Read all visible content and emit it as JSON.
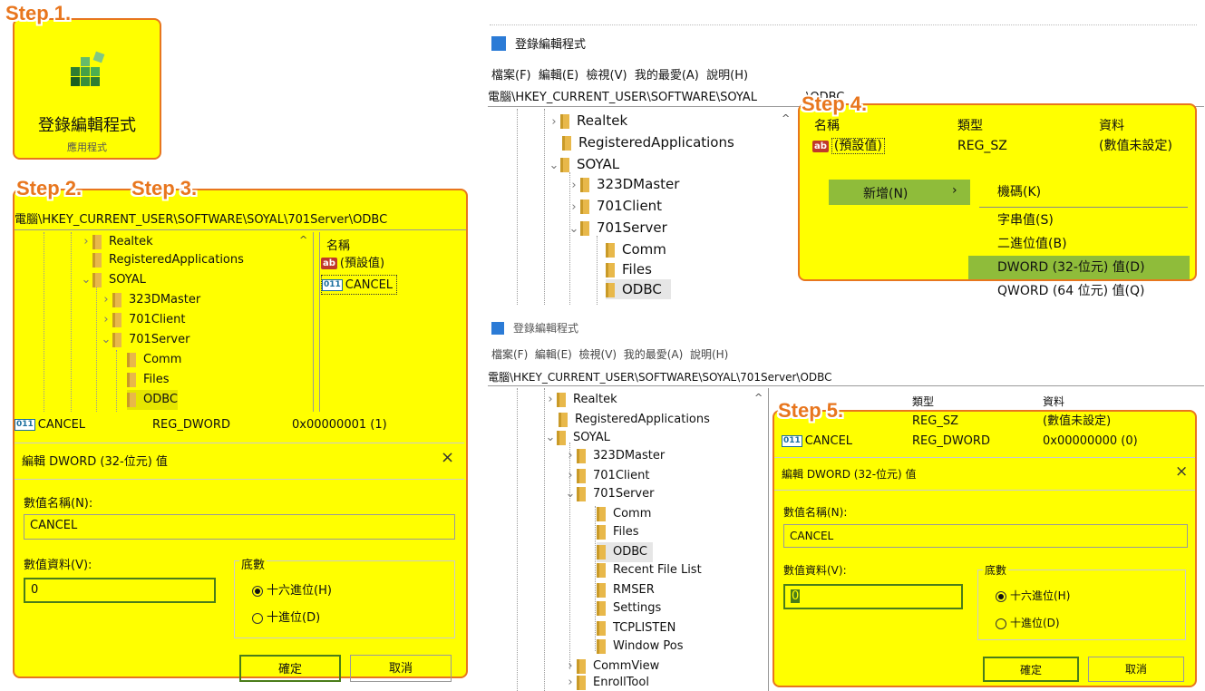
{
  "steps": {
    "s1": "Step 1.",
    "s2": "Step 2.",
    "s3": "Step 3.",
    "s4": "Step 4.",
    "s5": "Step 5."
  },
  "app_tile": {
    "title": "登錄編輯程式",
    "subtitle": "應用程式",
    "icon": "registry-editor-icon"
  },
  "registry": {
    "title": "登錄編輯程式",
    "menu": [
      "檔案(F)",
      "編輯(E)",
      "檢視(V)",
      "我的最愛(A)",
      "說明(H)"
    ],
    "path": "電腦\\HKEY_CURRENT_USER\\SOFTWARE\\SOYAL\\701Server\\ODBC",
    "path_top_left": "電腦\\HKEY_CURRENT_USER\\SOFTWARE\\SOYAL",
    "path_top_right": "\\ODBC",
    "tree": [
      "Realtek",
      "RegisteredApplications",
      "SOYAL",
      "323DMaster",
      "701Client",
      "701Server",
      "Comm",
      "Files",
      "ODBC",
      "Recent File List",
      "RMSER",
      "Settings",
      "TCPLISTEN",
      "Window Pos",
      "CommView",
      "EnrollTool"
    ],
    "columns": {
      "name": "名稱",
      "type": "類型",
      "data": "資料"
    },
    "default_value": {
      "name": "(預設值)",
      "type": "REG_SZ",
      "data": "(數值未設定)"
    },
    "cancel_value": {
      "name": "CANCEL",
      "type": "REG_DWORD",
      "data_before": "0x00000001 (1)",
      "data_after": "0x00000000 (0)"
    }
  },
  "context_menu": {
    "new_label": "新增(N)",
    "submenu": [
      "機碼(K)",
      "字串值(S)",
      "二進位值(B)",
      "DWORD (32-位元) 值(D)",
      "QWORD (64 位元) 值(Q)"
    ]
  },
  "dialog": {
    "title": "編輯 DWORD (32-位元) 值",
    "name_label": "數值名稱(N):",
    "name_value": "CANCEL",
    "data_label": "數值資料(V):",
    "data_value": "0",
    "base_label": "底數",
    "hex_label": "十六進位(H)",
    "dec_label": "十進位(D)",
    "ok": "確定",
    "cancel": "取消",
    "close": "×"
  },
  "colors": {
    "highlight": "#ffff00",
    "border": "#e8761e",
    "selection": "#8fbc3a"
  }
}
